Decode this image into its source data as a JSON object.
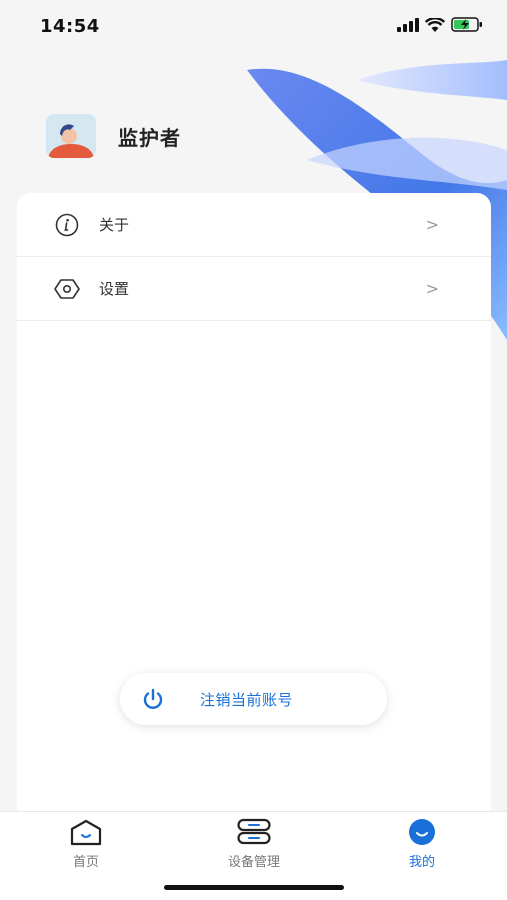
{
  "status_bar": {
    "time": "14:54"
  },
  "profile": {
    "username": "监护者"
  },
  "menu": {
    "items": [
      {
        "label": "关于",
        "icon": "info-icon",
        "arrow": ">"
      },
      {
        "label": "设置",
        "icon": "settings-icon",
        "arrow": ">"
      }
    ]
  },
  "logout": {
    "label": "注销当前账号",
    "icon": "power-icon"
  },
  "tab_bar": {
    "tabs": [
      {
        "label": "首页",
        "icon": "home-icon"
      },
      {
        "label": "设备管理",
        "icon": "device-icon"
      },
      {
        "label": "我的",
        "icon": "profile-icon",
        "active": true
      }
    ]
  },
  "colors": {
    "accent": "#1a6fd9",
    "background": "#f5f5f6",
    "card": "#ffffff"
  }
}
